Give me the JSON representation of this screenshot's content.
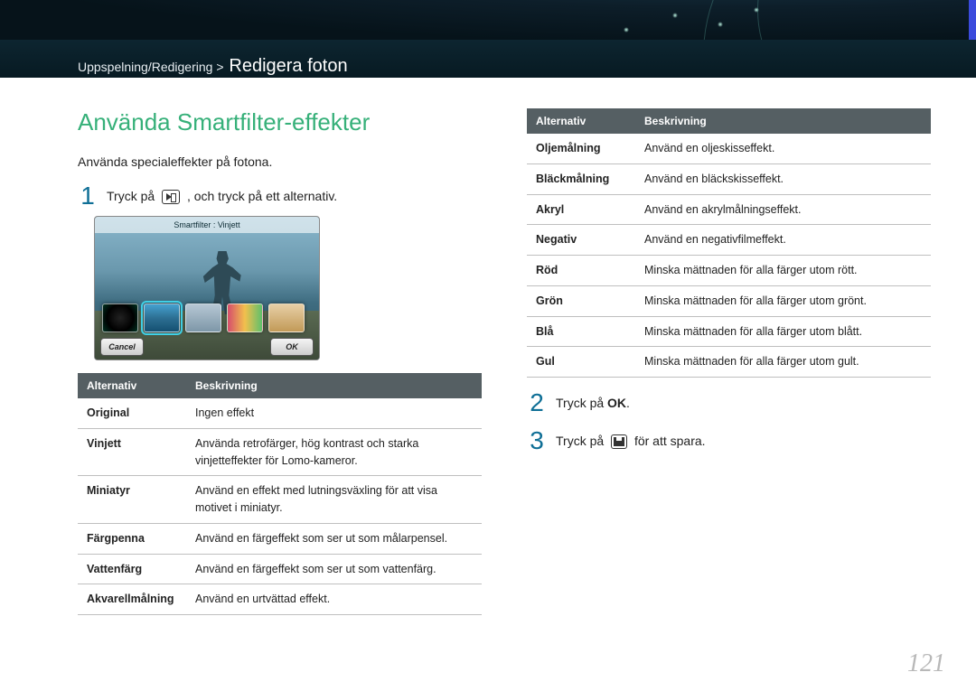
{
  "breadcrumb": {
    "parent": "Uppspelning/Redigering >",
    "title": "Redigera foton"
  },
  "section_title": "Använda Smartfilter-effekter",
  "intro": "Använda specialeffekter på fotona.",
  "steps": {
    "s1_a": "Tryck på",
    "s1_b": ", och tryck på ett alternativ.",
    "s2_a": "Tryck på",
    "s2_b": "OK",
    "s2_c": ".",
    "s3_a": "Tryck på",
    "s3_b": "för att spara."
  },
  "screenshot": {
    "header": "Smartfilter : Vinjett",
    "cancel": "Cancel",
    "ok": "OK"
  },
  "table1": {
    "h1": "Alternativ",
    "h2": "Beskrivning",
    "rows": [
      {
        "a": "Original",
        "b": "Ingen effekt"
      },
      {
        "a": "Vinjett",
        "b": "Använda retrofärger, hög kontrast och starka vinjetteffekter för Lomo-kameror."
      },
      {
        "a": "Miniatyr",
        "b": "Använd en effekt med lutningsväxling för att visa motivet i miniatyr."
      },
      {
        "a": "Färgpenna",
        "b": "Använd en färgeffekt som ser ut som målarpensel."
      },
      {
        "a": "Vattenfärg",
        "b": "Använd en färgeffekt som ser ut som vattenfärg."
      },
      {
        "a": "Akvarellmålning",
        "b": "Använd en urtvättad effekt."
      }
    ]
  },
  "table2": {
    "h1": "Alternativ",
    "h2": "Beskrivning",
    "rows": [
      {
        "a": "Oljemålning",
        "b": "Använd en oljeskisseffekt."
      },
      {
        "a": "Bläckmålning",
        "b": "Använd en bläckskisseffekt."
      },
      {
        "a": "Akryl",
        "b": "Använd en akrylmålningseffekt."
      },
      {
        "a": "Negativ",
        "b": "Använd en negativfilmeffekt."
      },
      {
        "a": "Röd",
        "b": "Minska mättnaden för alla färger utom rött."
      },
      {
        "a": "Grön",
        "b": "Minska mättnaden för alla färger utom grönt."
      },
      {
        "a": "Blå",
        "b": "Minska mättnaden för alla färger utom blått."
      },
      {
        "a": "Gul",
        "b": "Minska mättnaden för alla färger utom gult."
      }
    ]
  },
  "page_number": "121"
}
